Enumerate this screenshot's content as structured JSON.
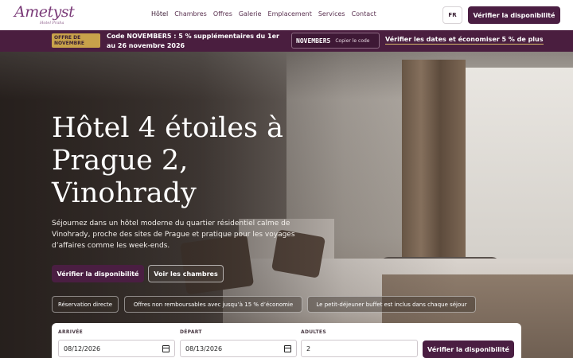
{
  "brand": {
    "logo_text": "Ametyst",
    "logo_sub": "Hotel Praha"
  },
  "nav": {
    "items": [
      {
        "label": "Hôtel",
        "active": true
      },
      {
        "label": "Chambres"
      },
      {
        "label": "Offres"
      },
      {
        "label": "Galerie"
      },
      {
        "label": "Emplacement"
      },
      {
        "label": "Services"
      },
      {
        "label": "Contact"
      }
    ],
    "lang": "FR",
    "cta": "Vérifier la disponibilité"
  },
  "promo": {
    "badge": "OFFRE DE NOVEMBRE",
    "text": "Code NOVEMBER5 : 5 % supplémentaires du 1er au 26 novembre 2026",
    "code": "NOVEMBER5",
    "copy_label": "Copier le code",
    "link": "Vérifier les dates et économiser 5 % de plus"
  },
  "hero": {
    "title": "Hôtel 4 étoiles à Prague 2, Vinohrady",
    "description": "Séjournez dans un hôtel moderne du quartier résidentiel calme de Vinohrady, proche des sites de Prague et pratique pour les voyages d’affaires comme les week-ends.",
    "primary_cta": "Vérifier la disponibilité",
    "secondary_cta": "Voir les chambres",
    "chips": [
      "Réservation directe",
      "Offres non remboursables avec jusqu’à 15 % d’économie",
      "Le petit-déjeuner buffet est inclus dans chaque séjour"
    ]
  },
  "booking": {
    "arrival_label": "ARRIVÉE",
    "arrival_value": "08/12/2026",
    "departure_label": "DÉPART",
    "departure_value": "08/13/2026",
    "adults_label": "ADULTES",
    "adults_value": "2",
    "submit": "Vérifier la disponibilité"
  },
  "colors": {
    "brand": "#4a1e42",
    "promo_bg": "#4a1e3f",
    "badge": "#c8a24a"
  }
}
